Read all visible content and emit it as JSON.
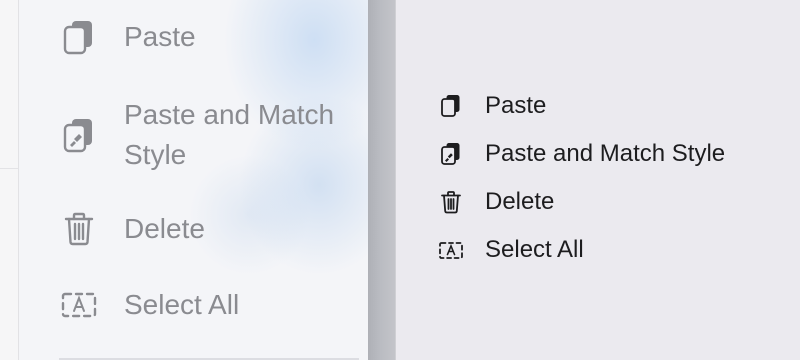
{
  "blurred_menu": {
    "items": [
      {
        "label": "Paste",
        "icon": "paste-icon"
      },
      {
        "label": "Paste and Match Style",
        "icon": "paste-match-style-icon"
      },
      {
        "label": "Delete",
        "icon": "trash-icon"
      },
      {
        "label": "Select All",
        "icon": "select-all-icon"
      }
    ]
  },
  "context_menu": {
    "items": [
      {
        "label": "Paste",
        "icon": "paste-icon"
      },
      {
        "label": "Paste and Match Style",
        "icon": "paste-match-style-icon"
      },
      {
        "label": "Delete",
        "icon": "trash-icon"
      },
      {
        "label": "Select All",
        "icon": "select-all-icon"
      }
    ]
  },
  "colors": {
    "background": "#ebeaef",
    "blurred_text": "#8a8b90",
    "menu_text": "#1d1d1f",
    "divider": "#b4b6bc"
  }
}
